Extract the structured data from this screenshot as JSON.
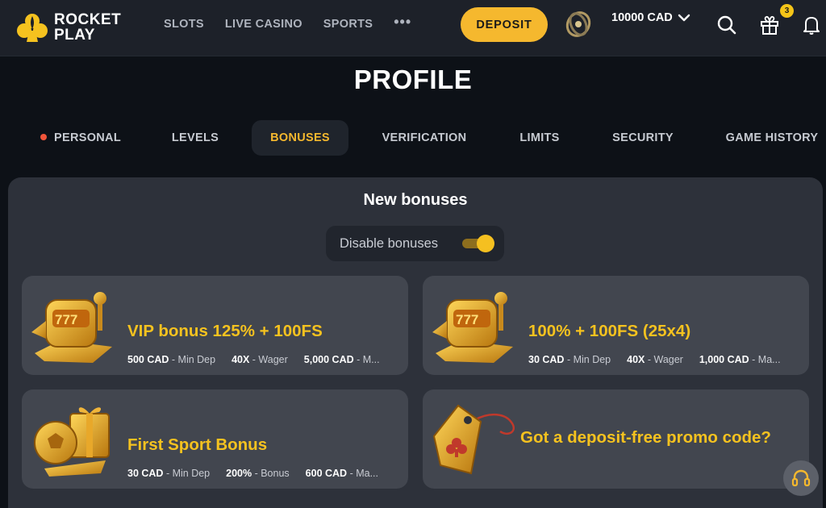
{
  "brand": {
    "line1": "ROCKET",
    "line2": "PLAY"
  },
  "nav": {
    "slots": "SLOTS",
    "live_casino": "LIVE CASINO",
    "sports": "SPORTS",
    "more": "•••"
  },
  "header": {
    "deposit_label": "DEPOSIT",
    "balance": "10000 CAD",
    "gift_count": "3"
  },
  "page": {
    "title": "PROFILE"
  },
  "tabs": [
    {
      "label": "PERSONAL",
      "has_alert": true
    },
    {
      "label": "LEVELS"
    },
    {
      "label": "BONUSES",
      "active": true
    },
    {
      "label": "VERIFICATION"
    },
    {
      "label": "LIMITS"
    },
    {
      "label": "SECURITY"
    },
    {
      "label": "GAME HISTORY"
    }
  ],
  "bonuses": {
    "title": "New bonuses",
    "toggle_label": "Disable bonuses",
    "toggle_on": true,
    "cards": [
      {
        "title": "VIP bonus 125% + 100FS",
        "meta": [
          {
            "value": "500 CAD",
            "label": " - Min Dep"
          },
          {
            "value": "40X",
            "label": " - Wager"
          },
          {
            "value": "5,000 CAD",
            "label": " - M..."
          }
        ]
      },
      {
        "title": "100% + 100FS (25x4)",
        "meta": [
          {
            "value": "30 CAD",
            "label": " - Min Dep"
          },
          {
            "value": "40X",
            "label": " - Wager"
          },
          {
            "value": "1,000 CAD",
            "label": " - Ma..."
          }
        ]
      },
      {
        "title": "First Sport Bonus",
        "meta": [
          {
            "value": "30 CAD",
            "label": " - Min Dep"
          },
          {
            "value": "200%",
            "label": " - Bonus"
          },
          {
            "value": "600 CAD",
            "label": " - Ma..."
          }
        ]
      }
    ],
    "promo_title": "Got a deposit-free promo code?"
  },
  "colors": {
    "accent": "#f5b82e",
    "bg": "#0d1117",
    "header": "#1d2129",
    "panel": "#2d313a",
    "card": "#42464f",
    "alert_dot": "#f0553a"
  },
  "icons": [
    "rocket-play-logo-icon",
    "avatar-icon",
    "chevron-down-icon",
    "search-icon",
    "gift-icon",
    "bell-icon",
    "slot-machine-icon",
    "soccer-gift-icon",
    "promo-tag-icon",
    "headset-icon"
  ]
}
